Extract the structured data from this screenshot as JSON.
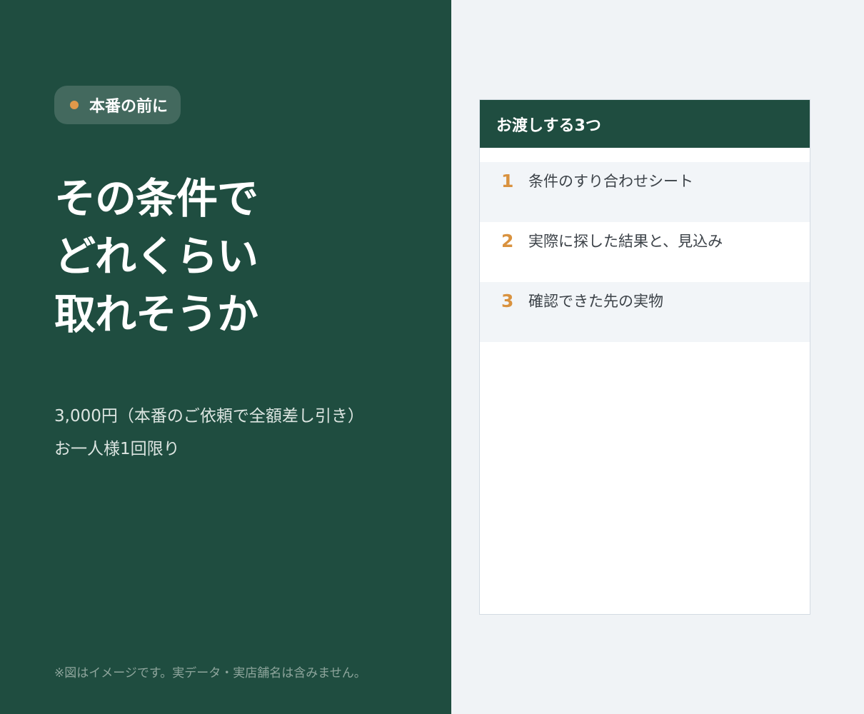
{
  "badge": {
    "label": "本番の前に"
  },
  "headline": {
    "lines": [
      "その条件で",
      "どれくらい",
      "取れそうか"
    ]
  },
  "price": {
    "line1": "3,000円（本番のご依頼で全額差し引き）",
    "line2": "お一人様1回限り"
  },
  "note": "※図はイメージです。実データ・実店舗名は含みません。",
  "card": {
    "title": "お渡しする3つ",
    "items": [
      {
        "num": "1",
        "text": "条件のすり合わせシート"
      },
      {
        "num": "2",
        "text": "実際に探した結果と、見込み"
      },
      {
        "num": "3",
        "text": "確認できた先の実物"
      }
    ]
  },
  "colors": {
    "panel_green": "#1f4d40",
    "accent_orange": "#e0994a",
    "background": "#f0f3f6"
  }
}
